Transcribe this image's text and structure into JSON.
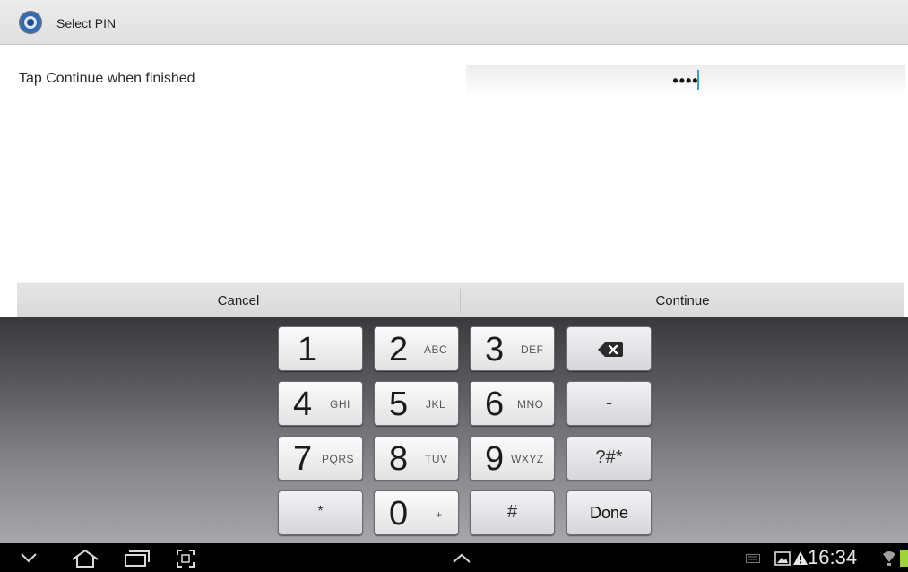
{
  "title_bar": {
    "title": "Select PIN",
    "icon": "settings-gear-icon"
  },
  "main": {
    "prompt": "Tap Continue when finished",
    "pin_field": {
      "value": "••••"
    }
  },
  "actions": {
    "cancel_label": "Cancel",
    "continue_label": "Continue"
  },
  "keypad": {
    "keys": [
      {
        "num": "1",
        "letters": ""
      },
      {
        "num": "2",
        "letters": "ABC"
      },
      {
        "num": "3",
        "letters": "DEF"
      },
      {
        "num": "4",
        "letters": "GHI"
      },
      {
        "num": "5",
        "letters": "JKL"
      },
      {
        "num": "6",
        "letters": "MNO"
      },
      {
        "num": "7",
        "letters": "PQRS"
      },
      {
        "num": "8",
        "letters": "TUV"
      },
      {
        "num": "9",
        "letters": "WXYZ"
      },
      {
        "num": "*",
        "letters": ""
      },
      {
        "num": "0",
        "letters": "+"
      },
      {
        "num": "#",
        "letters": ""
      }
    ],
    "backspace_icon": "backspace-icon",
    "dash_label": "-",
    "symbols_label": "?#*",
    "done_label": "Done"
  },
  "status_bar": {
    "time": "16:34",
    "accent_color": "#33a1de"
  }
}
